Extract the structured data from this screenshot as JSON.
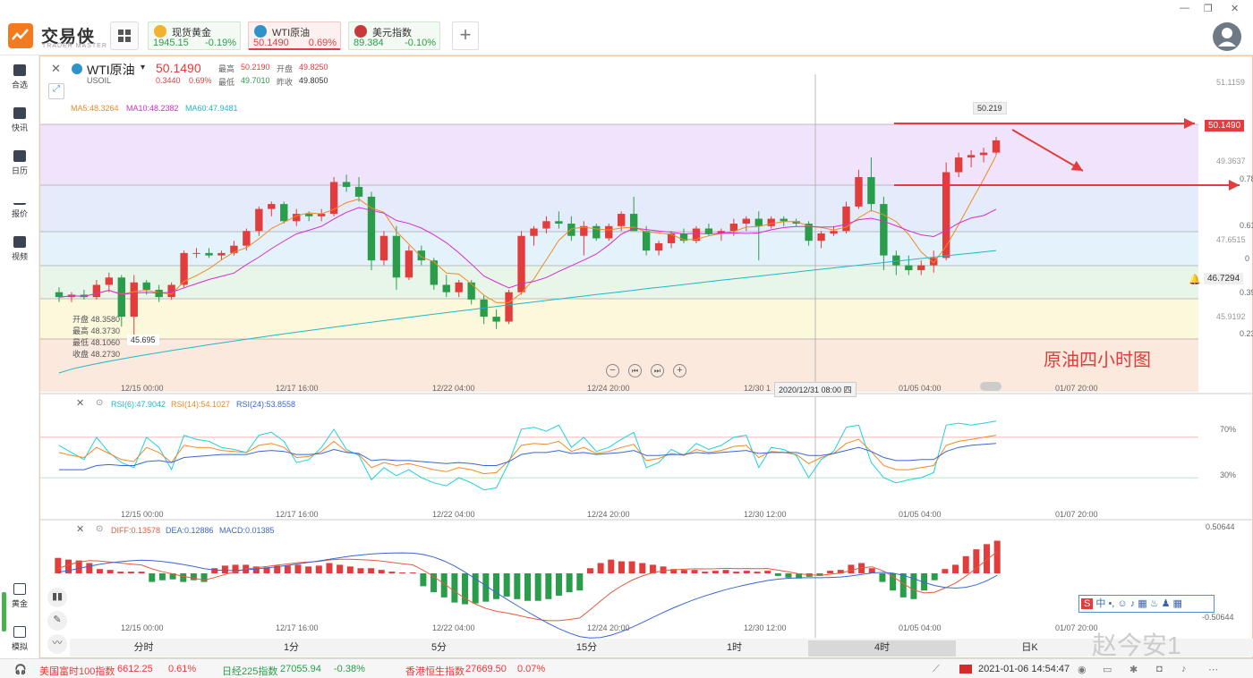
{
  "app": {
    "name": "交易侠",
    "sub": "TRADER MASTER"
  },
  "tickers": [
    {
      "name": "现货黄金",
      "price": "1945.15",
      "change": "-0.19%",
      "price_color": "#2a9d4b",
      "change_color": "#2a9d4b"
    },
    {
      "name": "WTI原油",
      "price": "50.1490",
      "change": "0.69%",
      "price_color": "#e23c3c",
      "change_color": "#e23c3c"
    },
    {
      "name": "美元指数",
      "price": "89.384",
      "change": "-0.10%",
      "price_color": "#2a9d4b",
      "change_color": "#2a9d4b"
    }
  ],
  "sidebar": {
    "items": [
      {
        "label": "合选",
        "icon": "bookmark-icon"
      },
      {
        "label": "快讯",
        "icon": "news-icon"
      },
      {
        "label": "日历",
        "icon": "calendar-icon"
      },
      {
        "label": "报价",
        "icon": "quote-icon"
      },
      {
        "label": "视频",
        "icon": "video-icon"
      },
      {
        "label": "黄金",
        "icon": "gold-icon"
      },
      {
        "label": "模拟",
        "icon": "wallet-icon"
      }
    ]
  },
  "symbol": {
    "name": "WTI原油",
    "code": "USOIL",
    "price": "50.1490",
    "change": "0.3440",
    "change_pct": "0.69%",
    "high_label": "最高",
    "high": "50.2190",
    "open_label": "开盘",
    "open": "49.8250",
    "low_label": "最低",
    "low": "49.7010",
    "prev_label": "昨收",
    "prev": "49.8050"
  },
  "ma": {
    "ma5": "MA5:48.3264",
    "ma10": "MA10:48.2382",
    "ma60": "MA60:47.9481"
  },
  "price_axis": [
    "51.1159",
    "49.3637",
    "47.6515",
    "45.9192"
  ],
  "price_axis_partial": [
    "0.78",
    "0.61",
    "0",
    "0.39",
    "0.23"
  ],
  "current_price_tag": "50.1490",
  "alert_price": "46.7294",
  "hover_high": "50.219",
  "low_marker": "45.695",
  "tooltip": {
    "open": "开盘 48.3580",
    "high": "最高 48.3730",
    "low": "最低 48.1060",
    "close": "收盘 48.2730"
  },
  "annotation": "原油四小时图",
  "crosshair_time": "2020/12/31 08:00 四",
  "time_labels": [
    "12/15 00:00",
    "12/17 16:00",
    "12/22 04:00",
    "12/24 20:00",
    "12/30 1",
    "01/05 04:00",
    "01/07 20:00"
  ],
  "time_labels_b": [
    "12/15 00:00",
    "12/17 16:00",
    "12/22 04:00",
    "12/24 20:00",
    "12/30 12:00",
    "01/05 04:00",
    "01/07 20:00"
  ],
  "rsi": {
    "r6": "RSI(6):47.9042",
    "r14": "RSI(14):54.1027",
    "r24": "RSI(24):53.8558",
    "lvl70": "70%",
    "lvl30": "30%"
  },
  "macd": {
    "diff": "DIFF:0.13578",
    "dea": "DEA:0.12886",
    "macd": "MACD:0.01385",
    "top": "0.50644",
    "bottom": "-0.50644"
  },
  "timeframes": [
    "分时",
    "1分",
    "5分",
    "15分",
    "1时",
    "4时",
    "日K"
  ],
  "active_timeframe": "4时",
  "bottom_bar": [
    {
      "name": "美国富时100指数",
      "value": "6612.25",
      "change": "0.61%",
      "color": "#e23c3c"
    },
    {
      "name": "日经225指数",
      "value": "27055.94",
      "change": "-0.38%",
      "color": "#2a9d4b"
    },
    {
      "name": "香港恒生指数",
      "value": "27669.50",
      "change": "0.07%",
      "color": "#e23c3c"
    }
  ],
  "datetime": "2021-01-06 14:54:47",
  "watermark": "赵今安1",
  "chart_data": {
    "type": "candlestick",
    "title": "",
    "ylim": [
      45.2,
      51.5
    ],
    "ohlc": [
      [
        47.05,
        47.15,
        46.85,
        46.95
      ],
      [
        46.95,
        47.05,
        46.85,
        47.0
      ],
      [
        47.0,
        47.1,
        46.9,
        46.95
      ],
      [
        46.95,
        47.3,
        46.9,
        47.2
      ],
      [
        47.2,
        47.45,
        47.05,
        47.35
      ],
      [
        47.35,
        47.4,
        46.35,
        46.55
      ],
      [
        46.55,
        47.4,
        46.0,
        47.25
      ],
      [
        47.25,
        47.3,
        47.0,
        47.1
      ],
      [
        47.1,
        47.2,
        46.85,
        46.95
      ],
      [
        46.95,
        47.25,
        46.9,
        47.2
      ],
      [
        47.2,
        47.9,
        47.15,
        47.85
      ],
      [
        47.85,
        47.95,
        47.75,
        47.85
      ],
      [
        47.85,
        47.95,
        47.75,
        47.8
      ],
      [
        47.8,
        47.9,
        47.7,
        47.85
      ],
      [
        47.85,
        48.1,
        47.8,
        48.0
      ],
      [
        48.0,
        48.35,
        47.9,
        48.3
      ],
      [
        48.3,
        48.8,
        48.2,
        48.75
      ],
      [
        48.75,
        48.9,
        48.6,
        48.85
      ],
      [
        48.85,
        48.9,
        48.45,
        48.5
      ],
      [
        48.5,
        48.75,
        48.4,
        48.65
      ],
      [
        48.65,
        48.7,
        48.5,
        48.6
      ],
      [
        48.6,
        48.75,
        48.5,
        48.65
      ],
      [
        48.65,
        49.4,
        48.6,
        49.3
      ],
      [
        49.3,
        49.45,
        49.1,
        49.2
      ],
      [
        49.2,
        49.4,
        48.9,
        49.0
      ],
      [
        49.0,
        49.1,
        47.5,
        47.7
      ],
      [
        47.7,
        48.3,
        47.6,
        48.2
      ],
      [
        48.2,
        48.4,
        47.1,
        47.35
      ],
      [
        47.35,
        48.0,
        47.3,
        47.9
      ],
      [
        47.9,
        48.0,
        47.6,
        47.7
      ],
      [
        47.7,
        47.75,
        47.1,
        47.2
      ],
      [
        47.2,
        47.4,
        46.95,
        47.05
      ],
      [
        47.05,
        47.3,
        46.95,
        47.25
      ],
      [
        47.25,
        47.3,
        46.8,
        46.9
      ],
      [
        46.9,
        47.0,
        46.4,
        46.55
      ],
      [
        46.55,
        46.7,
        46.3,
        46.45
      ],
      [
        46.45,
        47.1,
        46.4,
        47.05
      ],
      [
        47.05,
        48.3,
        47.0,
        48.2
      ],
      [
        48.2,
        48.4,
        48.0,
        48.35
      ],
      [
        48.35,
        48.6,
        48.25,
        48.5
      ],
      [
        48.5,
        48.7,
        48.35,
        48.45
      ],
      [
        48.45,
        48.6,
        48.1,
        48.2
      ],
      [
        48.2,
        48.5,
        47.8,
        48.4
      ],
      [
        48.4,
        48.45,
        48.1,
        48.15
      ],
      [
        48.15,
        48.45,
        48.1,
        48.4
      ],
      [
        48.4,
        48.7,
        48.3,
        48.65
      ],
      [
        48.65,
        49.0,
        48.5,
        48.3
      ],
      [
        48.3,
        48.4,
        47.8,
        47.9
      ],
      [
        47.9,
        48.1,
        47.8,
        48.05
      ],
      [
        48.05,
        48.3,
        47.95,
        48.25
      ],
      [
        48.25,
        48.35,
        48.05,
        48.1
      ],
      [
        48.1,
        48.4,
        48.05,
        48.35
      ],
      [
        48.35,
        48.45,
        48.2,
        48.25
      ],
      [
        48.25,
        48.35,
        48.1,
        48.3
      ],
      [
        48.3,
        48.55,
        48.2,
        48.45
      ],
      [
        48.45,
        48.6,
        48.3,
        48.55
      ],
      [
        48.55,
        48.7,
        47.7,
        48.4
      ],
      [
        48.4,
        48.6,
        48.35,
        48.55
      ],
      [
        48.55,
        48.6,
        48.4,
        48.5
      ],
      [
        48.5,
        48.55,
        48.4,
        48.45
      ],
      [
        48.45,
        48.5,
        48.0,
        48.1
      ],
      [
        48.1,
        48.3,
        47.95,
        48.25
      ],
      [
        48.25,
        48.4,
        48.2,
        48.3
      ],
      [
        48.3,
        48.9,
        48.25,
        48.8
      ],
      [
        48.8,
        49.55,
        48.75,
        49.4
      ],
      [
        49.4,
        49.8,
        48.7,
        48.85
      ],
      [
        48.85,
        49.0,
        47.5,
        47.8
      ],
      [
        47.8,
        47.9,
        47.4,
        47.6
      ],
      [
        47.6,
        47.8,
        47.4,
        47.5
      ],
      [
        47.5,
        47.7,
        47.4,
        47.6
      ],
      [
        47.6,
        47.9,
        47.45,
        47.75
      ],
      [
        47.75,
        49.7,
        47.7,
        49.5
      ],
      [
        49.5,
        49.9,
        49.4,
        49.8
      ],
      [
        49.8,
        49.95,
        49.6,
        49.85
      ],
      [
        49.85,
        50.0,
        49.7,
        49.9
      ],
      [
        49.9,
        50.22,
        49.85,
        50.15
      ]
    ],
    "rsi6": [
      62,
      55,
      48,
      70,
      55,
      45,
      40,
      70,
      60,
      38,
      72,
      68,
      66,
      60,
      58,
      55,
      72,
      75,
      66,
      45,
      48,
      60,
      78,
      58,
      52,
      28,
      40,
      32,
      38,
      30,
      25,
      22,
      30,
      25,
      18,
      20,
      45,
      78,
      80,
      76,
      82,
      60,
      70,
      56,
      60,
      68,
      75,
      40,
      45,
      58,
      52,
      64,
      58,
      62,
      70,
      72,
      40,
      60,
      58,
      52,
      30,
      48,
      56,
      80,
      82,
      45,
      30,
      25,
      28,
      30,
      35,
      82,
      84,
      82,
      84,
      86
    ],
    "rsi14": [
      55,
      52,
      50,
      60,
      54,
      48,
      46,
      60,
      55,
      45,
      62,
      60,
      60,
      57,
      56,
      55,
      62,
      64,
      60,
      50,
      51,
      56,
      66,
      56,
      53,
      40,
      45,
      42,
      44,
      41,
      38,
      36,
      40,
      38,
      34,
      35,
      47,
      62,
      64,
      63,
      66,
      56,
      60,
      54,
      56,
      60,
      63,
      47,
      49,
      54,
      52,
      58,
      55,
      57,
      61,
      62,
      50,
      56,
      55,
      53,
      44,
      50,
      54,
      64,
      68,
      56,
      42,
      38,
      38,
      40,
      42,
      62,
      66,
      68,
      70,
      72
    ],
    "rsi24": [
      38,
      38,
      38,
      42,
      43,
      42,
      42,
      46,
      47,
      45,
      50,
      51,
      52,
      53,
      53,
      53,
      56,
      57,
      56,
      53,
      53,
      54,
      58,
      55,
      54,
      47,
      48,
      47,
      47,
      46,
      45,
      44,
      45,
      44,
      42,
      42,
      46,
      53,
      55,
      55,
      57,
      54,
      55,
      53,
      54,
      55,
      57,
      52,
      52,
      53,
      53,
      55,
      54,
      55,
      56,
      57,
      54,
      55,
      55,
      55,
      52,
      52,
      54,
      57,
      60,
      56,
      50,
      47,
      47,
      48,
      48,
      56,
      60,
      62,
      63,
      64
    ],
    "macd_hist": [
      0.18,
      0.16,
      0.15,
      0.12,
      0.05,
      0.04,
      0.02,
      0.02,
      0.02,
      -0.1,
      -0.08,
      -0.07,
      -0.1,
      -0.08,
      -0.1,
      0.06,
      0.09,
      0.1,
      0.1,
      0.08,
      0.07,
      0.09,
      0.09,
      0.1,
      0.08,
      0.09,
      0.12,
      0.1,
      0.08,
      0.06,
      0.06,
      0.04,
      0.02,
      0.01,
      0.01,
      -0.15,
      -0.22,
      -0.28,
      -0.34,
      -0.36,
      -0.35,
      -0.33,
      -0.3,
      -0.27,
      -0.3,
      -0.32,
      -0.32,
      -0.3,
      -0.26,
      -0.22,
      -0.2,
      0.06,
      0.12,
      0.16,
      0.14,
      0.14,
      0.12,
      0.1,
      0.08,
      0.05,
      0.04,
      0.04,
      0.02,
      0.03,
      0.04,
      0.02,
      0.03,
      0.02,
      0.03,
      -0.03,
      -0.05,
      -0.06,
      -0.04,
      -0.03,
      0.03,
      0.04,
      0.1,
      0.12,
      0.06,
      -0.1,
      -0.2,
      -0.28,
      -0.3,
      -0.2,
      -0.08,
      0.05,
      0.1,
      0.2,
      0.28,
      0.34,
      0.38
    ]
  }
}
